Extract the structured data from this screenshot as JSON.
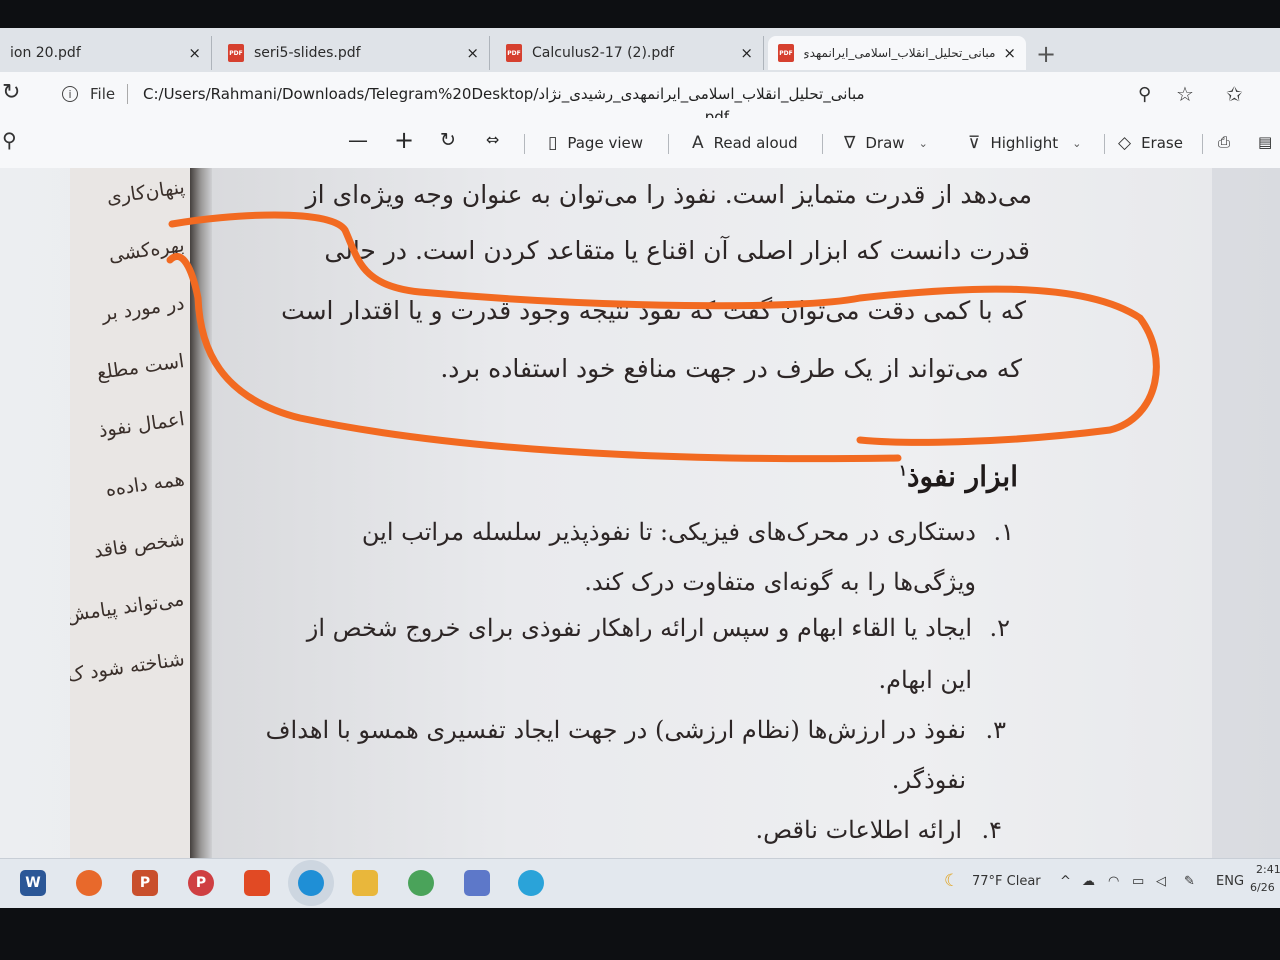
{
  "tabs": [
    {
      "label": "ion 20.pdf",
      "icon": "pdf-icon"
    },
    {
      "label": "seri5-slides.pdf",
      "icon": "pdf-icon"
    },
    {
      "label": "Calculus2-17 (2).pdf",
      "icon": "pdf-icon"
    },
    {
      "label": "مبانی_تحلیل_انقلاب_اسلامی_ایرانمهدی_رشـ",
      "icon": "pdf-icon",
      "active": true
    }
  ],
  "tab_close_glyph": "×",
  "new_tab_glyph": "+",
  "address": {
    "scheme_label": "File",
    "url": "C:/Users/Rahmani/Downloads/Telegram%20Desktop/مبانی_تحلیل_انقلاب_اسلامی_ایرانمهدی_رشیدی_نژاد",
    "url_continuation": ".pdf"
  },
  "toolbar": {
    "minus": "—",
    "plus": "+",
    "page_view": "Page view",
    "read_aloud": "Read aloud",
    "draw": "Draw",
    "highlight": "Highlight",
    "erase": "Erase"
  },
  "left_page_lines": [
    "پنهان‌کاری",
    "بهره‌کشی",
    "در مورد بر",
    "است مطلع",
    "اعمال نفوذ",
    "همه داده‌ه",
    "شخص فاقد",
    "می‌تواند پیامش",
    "شناخته شود ک"
  ],
  "document": {
    "paragraph_lines": [
      "می‌دهد از قدرت متمایز است. نفوذ را می‌توان به عنوان وجه ویژه‌ای از",
      "قدرت دانست که ابزار اصلی آن اقناع یا متقاعد کردن است. در حالی",
      "که با کمی دقت می‌توان گفت که نفوذ نتیجه وجود قدرت و یا اقتدار است",
      "که می‌تواند از یک طرف در جهت منافع خود استفاده برد."
    ],
    "heading": "ابزار نفوذ",
    "heading_footnote": "۱",
    "items": [
      {
        "number": "۱.",
        "lines": [
          "دستکاری در محرک‌های فیزیکی: تا نفوذپذیر سلسله مراتب این",
          "ویژگی‌ها را به گونه‌ای متفاوت درک کند."
        ]
      },
      {
        "number": "۲.",
        "lines": [
          "ایجاد یا القاء ابهام و سپس ارائه راهکار نفوذی برای خروج شخص از",
          "این ابهام."
        ]
      },
      {
        "number": "۳.",
        "lines": [
          "نفوذ در ارزش‌ها (نظام ارزشی) در جهت ایجاد تفسیری همسو با اهداف",
          "نفوذگر."
        ]
      },
      {
        "number": "۴.",
        "lines": [
          "ارائه اطلاعات ناقص."
        ]
      }
    ],
    "annotation_color": "#f26a21"
  },
  "taskbar": {
    "apps": [
      {
        "name": "word",
        "label": "W",
        "color": "#2b5797"
      },
      {
        "name": "firefox",
        "label": "",
        "color": "#e8692b"
      },
      {
        "name": "powerpoint",
        "label": "P",
        "color": "#c94f2c"
      },
      {
        "name": "publisher",
        "label": "P",
        "color": "#cf3f42"
      },
      {
        "name": "office",
        "label": "",
        "color": "#e14a24"
      },
      {
        "name": "edge",
        "label": "",
        "color": "#1f8fd6"
      },
      {
        "name": "file-explorer",
        "label": "",
        "color": "#e9b73b"
      },
      {
        "name": "chrome",
        "label": "",
        "color": "#4aa35a"
      },
      {
        "name": "paint",
        "label": "",
        "color": "#5d78c9"
      },
      {
        "name": "telegram",
        "label": "",
        "color": "#2aa3d9"
      }
    ],
    "weather": "77°F Clear",
    "language": "ENG",
    "time": "2:41",
    "date": "6/26"
  }
}
